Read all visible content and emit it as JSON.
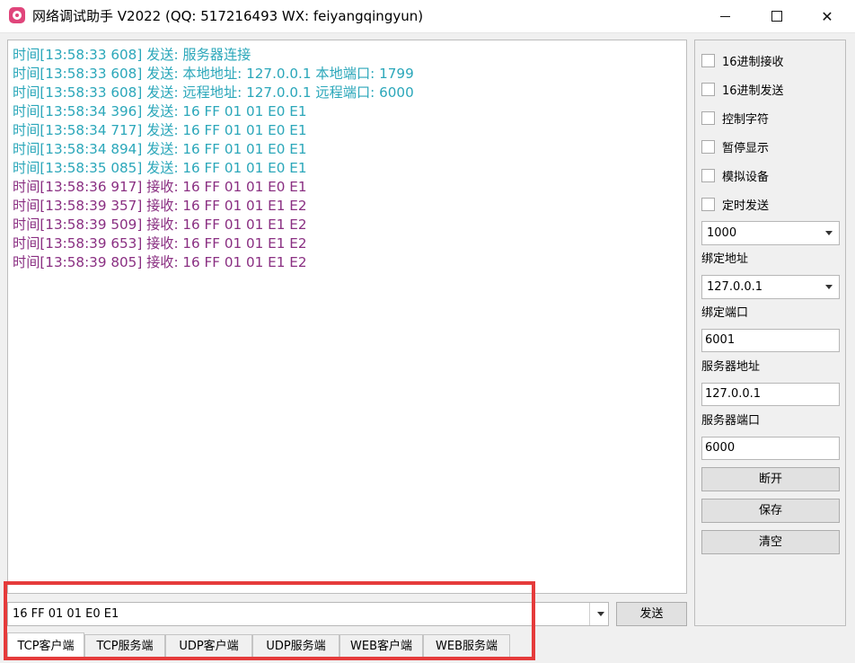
{
  "window": {
    "title": "网络调试助手 V2022 (QQ: 517216493 WX: feiyangqingyun)"
  },
  "log": [
    {
      "type": "sent",
      "text": "时间[13:58:33 608] 发送: 服务器连接"
    },
    {
      "type": "sent",
      "text": "时间[13:58:33 608] 发送: 本地地址: 127.0.0.1  本地端口: 1799"
    },
    {
      "type": "sent",
      "text": "时间[13:58:33 608] 发送: 远程地址: 127.0.0.1  远程端口: 6000"
    },
    {
      "type": "sent",
      "text": "时间[13:58:34 396] 发送: 16 FF 01 01 E0 E1"
    },
    {
      "type": "sent",
      "text": "时间[13:58:34 717] 发送: 16 FF 01 01 E0 E1"
    },
    {
      "type": "sent",
      "text": "时间[13:58:34 894] 发送: 16 FF 01 01 E0 E1"
    },
    {
      "type": "sent",
      "text": "时间[13:58:35 085] 发送: 16 FF 01 01 E0 E1"
    },
    {
      "type": "recv",
      "text": "时间[13:58:36 917] 接收: 16 FF 01 01 E0 E1"
    },
    {
      "type": "recv",
      "text": "时间[13:58:39 357] 接收: 16 FF 01 01 E1 E2"
    },
    {
      "type": "recv",
      "text": "时间[13:58:39 509] 接收: 16 FF 01 01 E1 E2"
    },
    {
      "type": "recv",
      "text": "时间[13:58:39 653] 接收: 16 FF 01 01 E1 E2"
    },
    {
      "type": "recv",
      "text": "时间[13:58:39 805] 接收: 16 FF 01 01 E1 E2"
    }
  ],
  "sidebar": {
    "checks": [
      "16进制接收",
      "16进制发送",
      "控制字符",
      "暂停显示",
      "模拟设备",
      "定时发送"
    ],
    "interval": "1000",
    "bind_addr_label": "绑定地址",
    "bind_addr": "127.0.0.1",
    "bind_port_label": "绑定端口",
    "bind_port": "6001",
    "server_addr_label": "服务器地址",
    "server_addr": "127.0.0.1",
    "server_port_label": "服务器端口",
    "server_port": "6000",
    "disconnect_label": "断开",
    "save_label": "保存",
    "clear_label": "清空"
  },
  "send": {
    "value": "16 FF 01 01 E0 E1",
    "button_label": "发送"
  },
  "tabs": [
    "TCP客户端",
    "TCP服务端",
    "UDP客户端",
    "UDP服务端",
    "WEB客户端",
    "WEB服务端"
  ],
  "colors": {
    "sent": "#2ba7ba",
    "received": "#8a2f82",
    "highlight": "#e53b3b"
  }
}
